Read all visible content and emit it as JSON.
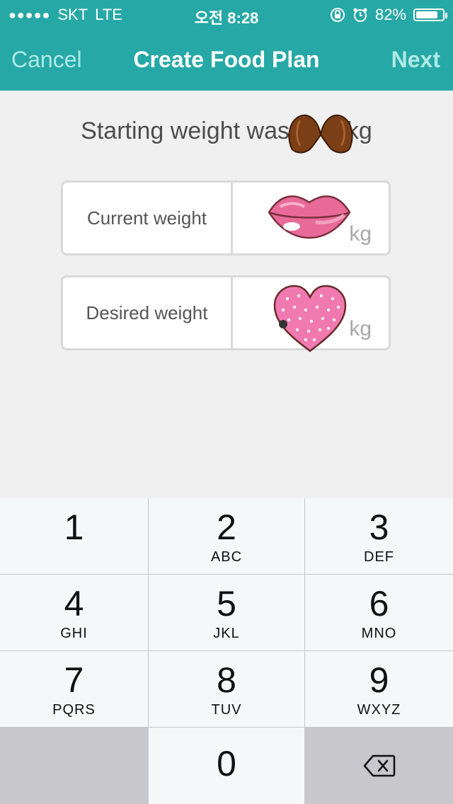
{
  "status_bar": {
    "carrier": "SKT",
    "network": "LTE",
    "time": "오전 8:28",
    "battery": "82%",
    "battery_level": 0.82
  },
  "nav": {
    "cancel_label": "Cancel",
    "title": "Create Food Plan",
    "next_label": "Next"
  },
  "summary": {
    "starting_weight_text": "Starting weight was",
    "unit": "kg"
  },
  "fields": {
    "current_weight_label": "Current weight",
    "current_weight_unit": "kg",
    "desired_weight_label": "Desired weight",
    "desired_weight_unit": "kg"
  },
  "keypad": {
    "keys": [
      {
        "num": "1",
        "letters": ""
      },
      {
        "num": "2",
        "letters": "ABC"
      },
      {
        "num": "3",
        "letters": "DEF"
      },
      {
        "num": "4",
        "letters": "GHI"
      },
      {
        "num": "5",
        "letters": "JKL"
      },
      {
        "num": "6",
        "letters": "MNO"
      },
      {
        "num": "7",
        "letters": "PQRS"
      },
      {
        "num": "8",
        "letters": "TUV"
      },
      {
        "num": "9",
        "letters": "WXYZ"
      },
      {
        "num": "0",
        "letters": ""
      }
    ]
  },
  "colors": {
    "header": "#26a8a6",
    "nav_action": "#aee9e6"
  }
}
